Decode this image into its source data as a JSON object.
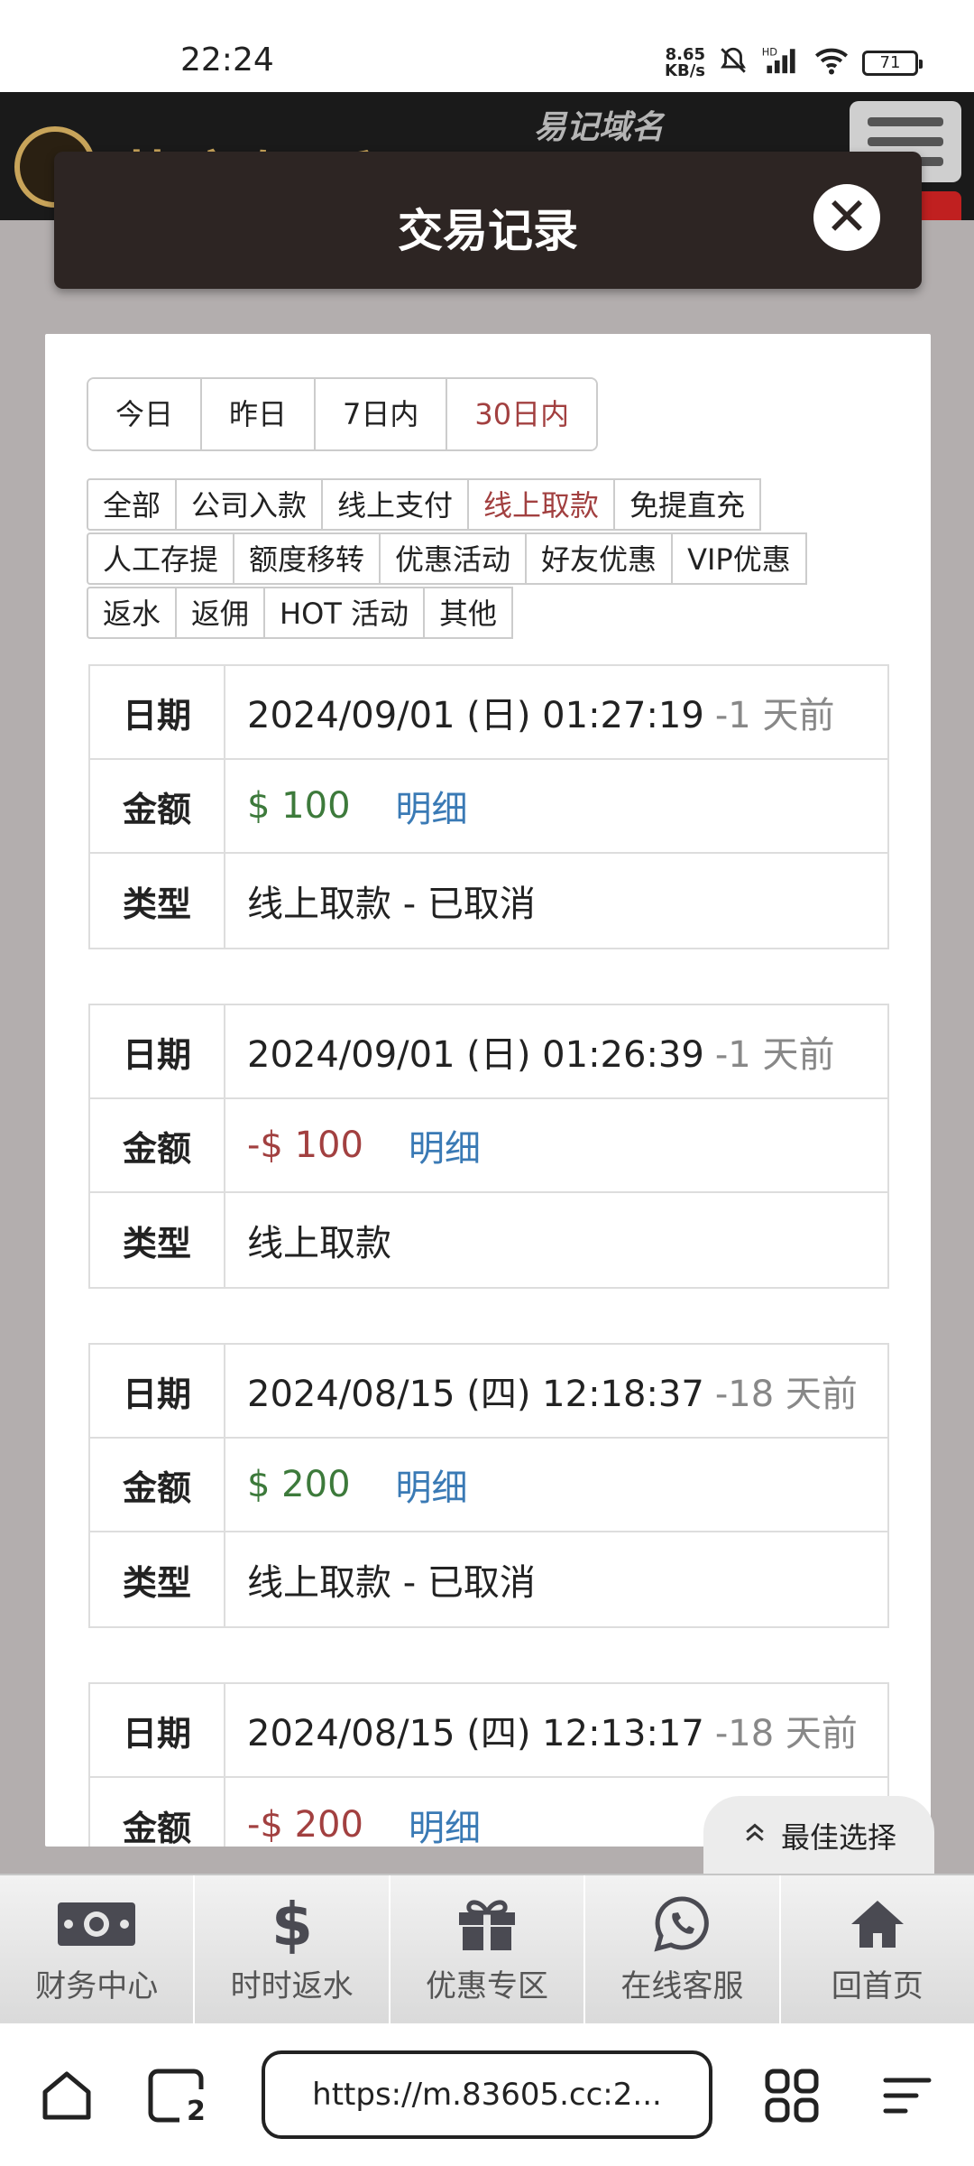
{
  "status_bar": {
    "time": "22:24",
    "net_speed_value": "8.65",
    "net_speed_unit": "KB/s",
    "battery": "71",
    "icons": [
      "mute-bell-icon",
      "hd-signal-icon",
      "wifi-icon",
      "battery-icon"
    ]
  },
  "site_header": {
    "brand": "葡京娱乐",
    "domain_label": "易记域名",
    "icons": [
      "logo-icon",
      "menu-icon"
    ]
  },
  "modal": {
    "title": "交易记录",
    "close_icon": "close-icon"
  },
  "date_ranges": {
    "items": [
      "今日",
      "昨日",
      "7日内",
      "30日内"
    ],
    "selected": "30日内"
  },
  "filters": {
    "rows": [
      [
        "全部",
        "公司入款",
        "线上支付",
        "线上取款",
        "免提直充"
      ],
      [
        "人工存提",
        "额度移转",
        "优惠活动",
        "好友优惠",
        "VIP优惠"
      ],
      [
        "返水",
        "返佣",
        "HOT 活动",
        "其他"
      ]
    ],
    "selected": "线上取款"
  },
  "labels": {
    "date": "日期",
    "amount": "金额",
    "type": "类型",
    "detail": "明细"
  },
  "records": [
    {
      "date": "2024/09/01 (日) 01:27:19",
      "ago": "-1 天前",
      "amount": "$ 100",
      "amount_sign": "positive",
      "type": "线上取款 - 已取消"
    },
    {
      "date": "2024/09/01 (日) 01:26:39",
      "ago": "-1 天前",
      "amount": "-$ 100",
      "amount_sign": "negative",
      "type": "线上取款"
    },
    {
      "date": "2024/08/15 (四) 12:18:37",
      "ago": "-18 天前",
      "amount": "$ 200",
      "amount_sign": "positive",
      "type": "线上取款 - 已取消"
    },
    {
      "date": "2024/08/15 (四) 12:13:17",
      "ago": "-18 天前",
      "amount": "-$ 200",
      "amount_sign": "negative",
      "type": ""
    }
  ],
  "best_pick": {
    "label": "最佳选择",
    "icon": "double-chevron-up-icon"
  },
  "bottom_nav": [
    {
      "label": "财务中心",
      "icon": "money-icon"
    },
    {
      "label": "时时返水",
      "icon": "dollar-icon"
    },
    {
      "label": "优惠专区",
      "icon": "gift-icon"
    },
    {
      "label": "在线客服",
      "icon": "whatsapp-icon"
    },
    {
      "label": "回首页",
      "icon": "home-icon"
    }
  ],
  "browser": {
    "url": "https://m.83605.cc:2...",
    "tab_count": "2",
    "icons": [
      "home-outline-icon",
      "tabs-icon",
      "apps-grid-icon",
      "menu-lines-icon"
    ]
  },
  "colors": {
    "active_red": "#a24040",
    "positive_green": "#3d7a3b",
    "detail_blue": "#3a7ab5",
    "modal_title_bg": "#2d2523",
    "overlay_gray": "#b3aeae"
  }
}
